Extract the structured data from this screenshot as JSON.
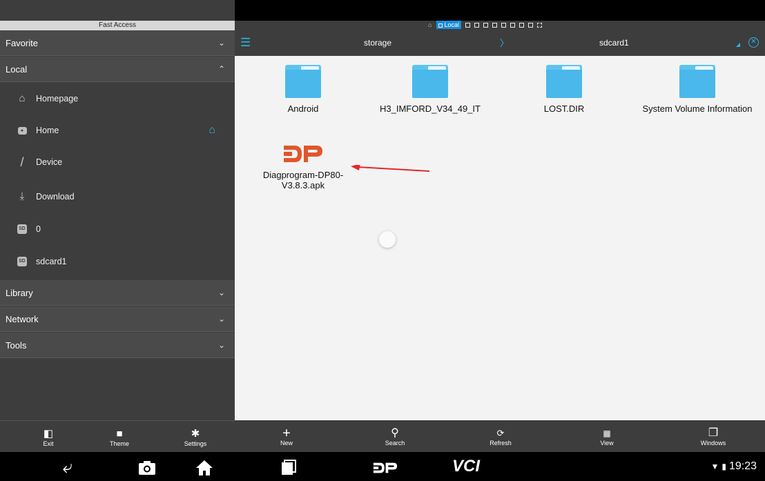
{
  "sidebar": {
    "title": "Fast Access",
    "sections": [
      {
        "label": "Favorite",
        "chevron": "chevron-down"
      },
      {
        "label": "Local",
        "chevron": "chevron-up"
      },
      {
        "label": "Library",
        "chevron": "chevron-down"
      },
      {
        "label": "Network",
        "chevron": "chevron-down"
      },
      {
        "label": "Tools",
        "chevron": "chevron-down"
      }
    ],
    "items": [
      {
        "label": "Homepage",
        "icon": "house-outline-icon"
      },
      {
        "label": "Home",
        "icon": "folder-image-icon"
      },
      {
        "label": "Device",
        "icon": "slash-icon"
      },
      {
        "label": "Download",
        "icon": "download-icon"
      },
      {
        "label": "0",
        "icon": "sd-card-icon",
        "badge": "SD"
      },
      {
        "label": "sdcard1",
        "icon": "sd-card-icon",
        "badge": "SD"
      }
    ],
    "bottom_tools": [
      {
        "label": "Exit",
        "icon": "exit-icon"
      },
      {
        "label": "Theme",
        "icon": "tshirt-icon"
      },
      {
        "label": "Settings",
        "icon": "gear-icon"
      }
    ]
  },
  "window_strip": {
    "active_label": "Local"
  },
  "pathbar": {
    "segments": [
      "storage",
      "sdcard1"
    ]
  },
  "files": [
    {
      "name": "Android",
      "type": "folder"
    },
    {
      "name": "H3_IMFORD_V34_49_IT",
      "type": "folder"
    },
    {
      "name": "LOST.DIR",
      "type": "folder"
    },
    {
      "name": "System Volume Information",
      "type": "folder"
    },
    {
      "name_line1": "Diagprogram-DP80-",
      "name_line2": "V3.8.3.apk",
      "type": "apk",
      "logo_text": "DP"
    }
  ],
  "toolbar": [
    {
      "label": "New",
      "icon": "plus-icon"
    },
    {
      "label": "Search",
      "icon": "search-icon"
    },
    {
      "label": "Refresh",
      "icon": "refresh-icon"
    },
    {
      "label": "View",
      "icon": "grid-icon"
    },
    {
      "label": "Windows",
      "icon": "windows-icon"
    }
  ],
  "navbar": {
    "time": "19:23",
    "vci_label": "VCI"
  },
  "colors": {
    "accent": "#2ab7e8",
    "sidebar_bg": "#3d3d3d",
    "folder": "#4ab8ea",
    "dp_logo": "#e2562a",
    "arrow": "#e8262a"
  }
}
